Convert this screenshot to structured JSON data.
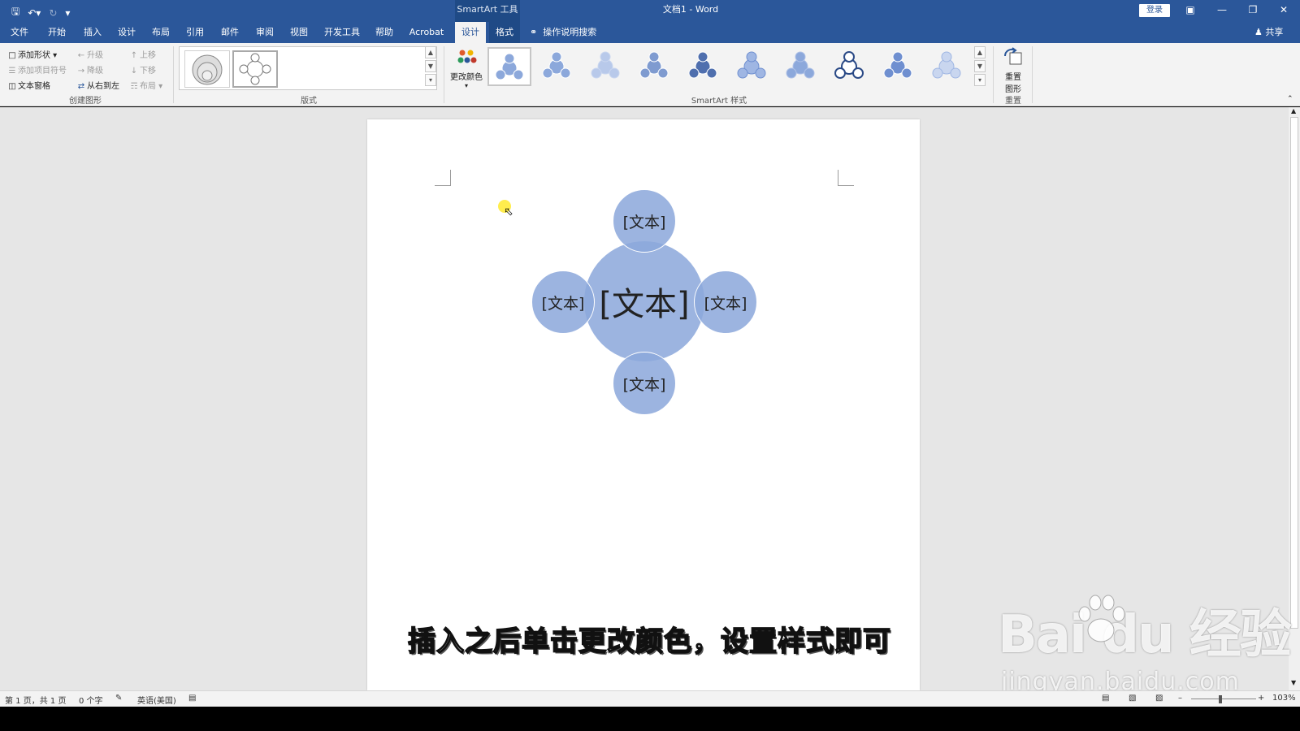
{
  "titlebar": {
    "app_title": "文档1 - Word",
    "context_tools": "SmartArt 工具",
    "login_label": "登录",
    "qat_icons": [
      "save-icon",
      "undo-icon",
      "redo-icon",
      "customize-icon"
    ]
  },
  "tabs": [
    {
      "label": "文件"
    },
    {
      "label": "开始"
    },
    {
      "label": "插入"
    },
    {
      "label": "设计"
    },
    {
      "label": "布局"
    },
    {
      "label": "引用"
    },
    {
      "label": "邮件"
    },
    {
      "label": "审阅"
    },
    {
      "label": "视图"
    },
    {
      "label": "开发工具"
    },
    {
      "label": "帮助"
    },
    {
      "label": "Acrobat"
    },
    {
      "label": "设计"
    },
    {
      "label": "格式"
    }
  ],
  "tell_me": "操作说明搜索",
  "share": "共享",
  "ribbon": {
    "create_graphic": {
      "label": "创建图形",
      "add_shape": "添加形状",
      "add_bullet": "添加项目符号",
      "text_pane": "文本窗格",
      "promote": "升级",
      "demote": "降级",
      "right_to_left": "从右到左",
      "move_up": "上移",
      "move_down": "下移",
      "layout": "布局"
    },
    "layouts": {
      "label": "版式"
    },
    "styles": {
      "label": "SmartArt 样式",
      "change_colors": "更改颜色"
    },
    "reset": {
      "label": "重置",
      "reset_graphic_line1": "重置",
      "reset_graphic_line2": "图形"
    }
  },
  "smartart": {
    "center": "[文本]",
    "top": "[文本]",
    "left": "[文本]",
    "right": "[文本]",
    "bottom": "[文本]"
  },
  "caption": "插入之后单击更改颜色，设置样式即可",
  "watermark": {
    "brand": "Bai  du 经验",
    "url": "jingyan.baidu.com"
  },
  "statusbar": {
    "page": "第 1 页，共 1 页",
    "words": "0 个字",
    "language": "英语(美国)",
    "zoom": "103%"
  },
  "colors": {
    "accent": "#2b579a",
    "smartart_fill": "#8ca8db"
  }
}
